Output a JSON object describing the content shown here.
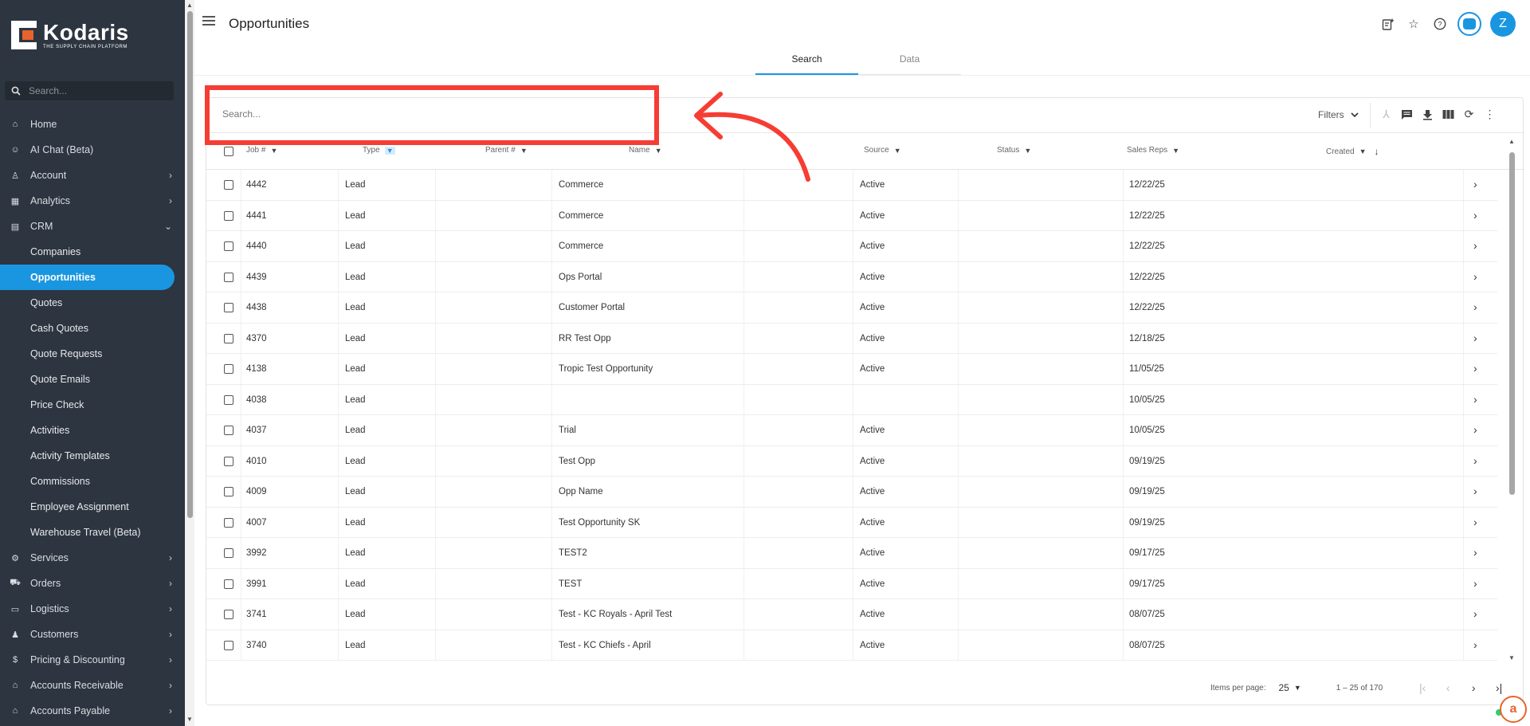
{
  "app": {
    "logo_name": "Kodaris",
    "logo_tagline": "THE SUPPLY CHAIN PLATFORM"
  },
  "sidebar": {
    "search_placeholder": "Search...",
    "items": [
      {
        "label": "Home",
        "icon": "home-icon",
        "glyph": "⌂",
        "expandable": false
      },
      {
        "label": "AI Chat (Beta)",
        "icon": "robot-icon",
        "glyph": "☺",
        "expandable": false
      },
      {
        "label": "Account",
        "icon": "person-icon",
        "glyph": "♙",
        "expandable": true
      },
      {
        "label": "Analytics",
        "icon": "analytics-icon",
        "glyph": "▦",
        "expandable": true
      },
      {
        "label": "CRM",
        "icon": "crm-icon",
        "glyph": "▤",
        "expandable": true,
        "expanded": true
      }
    ],
    "crm_sub": [
      "Companies",
      "Opportunities",
      "Quotes",
      "Cash Quotes",
      "Quote Requests",
      "Quote Emails",
      "Price Check",
      "Activities",
      "Activity Templates",
      "Commissions",
      "Employee Assignment",
      "Warehouse Travel (Beta)"
    ],
    "crm_active": "Opportunities",
    "items_after": [
      {
        "label": "Services",
        "icon": "services-icon",
        "glyph": "⚙"
      },
      {
        "label": "Orders",
        "icon": "truck-icon",
        "glyph": "⛟"
      },
      {
        "label": "Logistics",
        "icon": "logistics-icon",
        "glyph": "▭"
      },
      {
        "label": "Customers",
        "icon": "people-icon",
        "glyph": "♟"
      },
      {
        "label": "Pricing & Discounting",
        "icon": "dollar-icon",
        "glyph": "$"
      },
      {
        "label": "Accounts Receivable",
        "icon": "bank-icon",
        "glyph": "⌂"
      },
      {
        "label": "Accounts Payable",
        "icon": "bank-icon",
        "glyph": "⌂"
      }
    ]
  },
  "header": {
    "title": "Opportunities",
    "avatar_initial": "Z"
  },
  "tabs": [
    {
      "label": "Search",
      "active": true
    },
    {
      "label": "Data",
      "active": false
    }
  ],
  "grid": {
    "search_placeholder": "Search...",
    "filters_label": "Filters",
    "columns": [
      "Job #",
      "Type",
      "Parent #",
      "Name",
      "Source",
      "Status",
      "Sales Reps",
      "Created"
    ],
    "rows": [
      {
        "job": "4442",
        "type": "Lead",
        "parent": "",
        "name": "Commerce",
        "source": "",
        "status": "Active",
        "reps": "",
        "created": "12/22/25"
      },
      {
        "job": "4441",
        "type": "Lead",
        "parent": "",
        "name": "Commerce",
        "source": "",
        "status": "Active",
        "reps": "",
        "created": "12/22/25"
      },
      {
        "job": "4440",
        "type": "Lead",
        "parent": "",
        "name": "Commerce",
        "source": "",
        "status": "Active",
        "reps": "",
        "created": "12/22/25"
      },
      {
        "job": "4439",
        "type": "Lead",
        "parent": "",
        "name": "Ops Portal",
        "source": "",
        "status": "Active",
        "reps": "",
        "created": "12/22/25"
      },
      {
        "job": "4438",
        "type": "Lead",
        "parent": "",
        "name": "Customer Portal",
        "source": "",
        "status": "Active",
        "reps": "",
        "created": "12/22/25"
      },
      {
        "job": "4370",
        "type": "Lead",
        "parent": "",
        "name": "RR Test Opp",
        "source": "",
        "status": "Active",
        "reps": "",
        "created": "12/18/25"
      },
      {
        "job": "4138",
        "type": "Lead",
        "parent": "",
        "name": "Tropic Test Opportunity",
        "source": "",
        "status": "Active",
        "reps": "",
        "created": "11/05/25"
      },
      {
        "job": "4038",
        "type": "Lead",
        "parent": "",
        "name": "",
        "source": "",
        "status": "",
        "reps": "",
        "created": "10/05/25"
      },
      {
        "job": "4037",
        "type": "Lead",
        "parent": "",
        "name": "Trial",
        "source": "",
        "status": "Active",
        "reps": "",
        "created": "10/05/25"
      },
      {
        "job": "4010",
        "type": "Lead",
        "parent": "",
        "name": "Test Opp",
        "source": "",
        "status": "Active",
        "reps": "",
        "created": "09/19/25"
      },
      {
        "job": "4009",
        "type": "Lead",
        "parent": "",
        "name": "Opp Name",
        "source": "",
        "status": "Active",
        "reps": "",
        "created": "09/19/25"
      },
      {
        "job": "4007",
        "type": "Lead",
        "parent": "",
        "name": "Test Opportunity SK",
        "source": "",
        "status": "Active",
        "reps": "",
        "created": "09/19/25"
      },
      {
        "job": "3992",
        "type": "Lead",
        "parent": "",
        "name": "TEST2",
        "source": "",
        "status": "Active",
        "reps": "",
        "created": "09/17/25"
      },
      {
        "job": "3991",
        "type": "Lead",
        "parent": "",
        "name": "TEST",
        "source": "",
        "status": "Active",
        "reps": "",
        "created": "09/17/25"
      },
      {
        "job": "3741",
        "type": "Lead",
        "parent": "",
        "name": "Test - KC Royals - April Test",
        "source": "",
        "status": "Active",
        "reps": "",
        "created": "08/07/25"
      },
      {
        "job": "3740",
        "type": "Lead",
        "parent": "",
        "name": "Test - KC Chiefs - April",
        "source": "",
        "status": "Active",
        "reps": "",
        "created": "08/07/25"
      }
    ],
    "pager": {
      "items_per_page_label": "Items per page:",
      "items_per_page": "25",
      "range": "1 – 25 of 170"
    }
  },
  "colors": {
    "sidebar_bg": "#2d3540",
    "accent": "#1a96e0",
    "annotation": "#f63d34",
    "brand_orange": "#e8632b"
  }
}
